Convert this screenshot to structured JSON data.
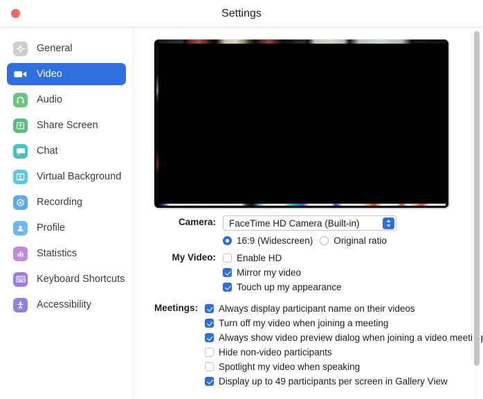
{
  "window": {
    "title": "Settings",
    "close_button": "close"
  },
  "sidebar": {
    "items": [
      {
        "label": "General",
        "icon": "gear-icon",
        "color": "#cdcdcd",
        "active": false
      },
      {
        "label": "Video",
        "icon": "video-camera-icon",
        "color": "#2d70e2",
        "active": true
      },
      {
        "label": "Audio",
        "icon": "headphones-icon",
        "color": "#6cc47f",
        "active": false
      },
      {
        "label": "Share Screen",
        "icon": "share-screen-icon",
        "color": "#58bd7e",
        "active": false
      },
      {
        "label": "Chat",
        "icon": "chat-bubble-icon",
        "color": "#49c1bd",
        "active": false
      },
      {
        "label": "Virtual Background",
        "icon": "virtual-background-icon",
        "color": "#5cc8e8",
        "active": false
      },
      {
        "label": "Recording",
        "icon": "record-icon",
        "color": "#5aade8",
        "active": false
      },
      {
        "label": "Profile",
        "icon": "person-icon",
        "color": "#6fb7f3",
        "active": false
      },
      {
        "label": "Statistics",
        "icon": "bar-chart-icon",
        "color": "#bd8ae0",
        "active": false
      },
      {
        "label": "Keyboard Shortcuts",
        "icon": "keyboard-icon",
        "color": "#9a7ce2",
        "active": false
      },
      {
        "label": "Accessibility",
        "icon": "accessibility-icon",
        "color": "#8a83e8",
        "active": false
      }
    ]
  },
  "main": {
    "preview": {
      "name": "camera-preview",
      "state": "black"
    },
    "camera": {
      "label": "Camera:",
      "selected": "FaceTime HD Camera (Built-in)",
      "stepper_icon": "up-down-chevron-icon"
    },
    "aspect_ratio": {
      "options": [
        {
          "label": "16:9 (Widescreen)",
          "selected": true
        },
        {
          "label": "Original ratio",
          "selected": false
        }
      ]
    },
    "my_video": {
      "label": "My Video:",
      "checkboxes": [
        {
          "label": "Enable HD",
          "checked": false
        },
        {
          "label": "Mirror my video",
          "checked": true
        },
        {
          "label": "Touch up my appearance",
          "checked": true
        }
      ]
    },
    "meetings": {
      "label": "Meetings:",
      "checkboxes": [
        {
          "label": "Always display participant name on their videos",
          "checked": true
        },
        {
          "label": "Turn off my video when joining a meeting",
          "checked": true
        },
        {
          "label": "Always show video preview dialog when joining a video meeting",
          "checked": true
        },
        {
          "label": "Hide non-video participants",
          "checked": false
        },
        {
          "label": "Spotlight my video when speaking",
          "checked": false
        },
        {
          "label": "Display up to 49 participants per screen in Gallery View",
          "checked": true
        }
      ]
    }
  },
  "scrollbar": {
    "name": "vertical-scrollbar"
  },
  "colors": {
    "accent": "#2d70e2",
    "close": "#f4685d",
    "text": "#1d1d1f"
  }
}
